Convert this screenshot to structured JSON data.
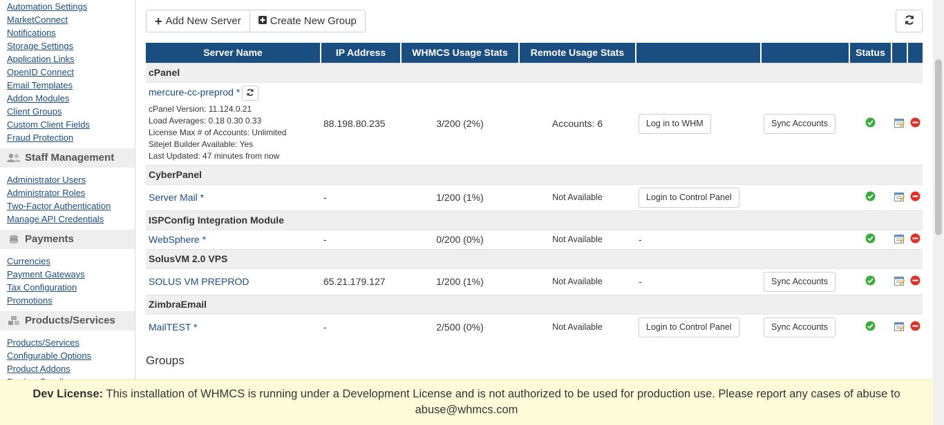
{
  "sidebar": {
    "setup_links": [
      "Automation Settings",
      "MarketConnect",
      "Notifications",
      "Storage Settings",
      "Application Links",
      "OpenID Connect",
      "Email Templates",
      "Addon Modules",
      "Client Groups",
      "Custom Client Fields",
      "Fraud Protection"
    ],
    "staff": {
      "title": "Staff Management",
      "icon": "users-icon",
      "links": [
        "Administrator Users",
        "Administrator Roles",
        "Two-Factor Authentication",
        "Manage API Credentials"
      ]
    },
    "payments": {
      "title": "Payments",
      "icon": "coins-icon",
      "links": [
        "Currencies",
        "Payment Gateways",
        "Tax Configuration",
        "Promotions"
      ]
    },
    "products": {
      "title": "Products/Services",
      "icon": "cubes-icon",
      "links": [
        "Products/Services",
        "Configurable Options",
        "Product Addons",
        "Product Bundles"
      ]
    }
  },
  "toolbar": {
    "add_server": "Add New Server",
    "create_group": "Create New Group"
  },
  "table": {
    "headers": [
      "Server Name",
      "IP Address",
      "WHMCS Usage Stats",
      "Remote Usage Stats",
      "",
      "",
      "Status",
      "",
      ""
    ],
    "groups": [
      {
        "name": "cPanel",
        "server": {
          "name": "mercure-cc-preprod *",
          "ip": "88.198.80.235",
          "usage": "3/200 (2%)",
          "remote": "Accounts: 6",
          "action1": "Log in to WHM",
          "action2": "Sync Accounts",
          "details": [
            "cPanel Version: 11.124.0.21",
            "Load Averages: 0.18 0.30 0.33",
            "License Max # of Accounts: Unlimited",
            "Sitejet Builder Available: Yes",
            "Last Updated: 47 minutes from now"
          ]
        }
      },
      {
        "name": "CyberPanel",
        "server": {
          "name": "Server Mail *",
          "ip": "-",
          "usage": "1/200 (1%)",
          "remote": "Not Available",
          "action1": "Login to Control Panel",
          "action2": ""
        }
      },
      {
        "name": "ISPConfig Integration Module",
        "server": {
          "name": "WebSphere *",
          "ip": "-",
          "usage": "0/200 (0%)",
          "remote": "Not Available",
          "action1": "-",
          "action2": ""
        }
      },
      {
        "name": "SolusVM 2.0 VPS",
        "server": {
          "name": "SOLUS VM PREPROD",
          "ip": "65.21.179.127",
          "usage": "1/200 (1%)",
          "remote": "Not Available",
          "action1": "-",
          "action2": "Sync Accounts"
        }
      },
      {
        "name": "ZimbraEmail",
        "server": {
          "name": "MailTEST *",
          "ip": "-",
          "usage": "2/500 (0%)",
          "remote": "Not Available",
          "action1": "Login to Control Panel",
          "action2": "Sync Accounts"
        }
      }
    ]
  },
  "groups_heading": "Groups",
  "banner": {
    "label": "Dev License:",
    "text": "This installation of WHMCS is running under a Development License and is not authorized to be used for production use. Please report any cases of abuse to abuse@whmcs.com"
  },
  "colors": {
    "header_bg": "#1a4d80",
    "link": "#1a4d80",
    "status_ok": "#3dab3d",
    "banner_bg": "#fdfbd8"
  }
}
